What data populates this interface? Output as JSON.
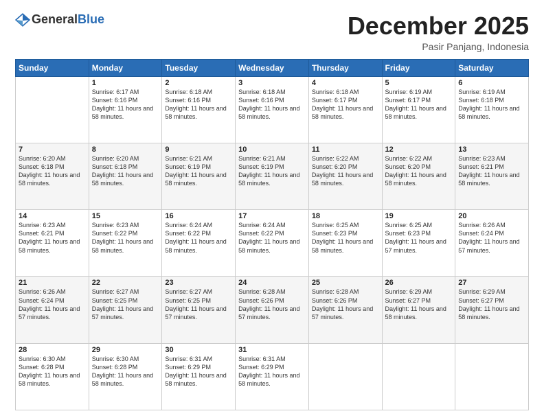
{
  "header": {
    "logo_general": "General",
    "logo_blue": "Blue",
    "month_title": "December 2025",
    "location": "Pasir Panjang, Indonesia"
  },
  "days_of_week": [
    "Sunday",
    "Monday",
    "Tuesday",
    "Wednesday",
    "Thursday",
    "Friday",
    "Saturday"
  ],
  "weeks": [
    [
      {
        "day": "",
        "sunrise": "",
        "sunset": "",
        "daylight": ""
      },
      {
        "day": "1",
        "sunrise": "6:17 AM",
        "sunset": "6:16 PM",
        "daylight": "11 hours and 58 minutes."
      },
      {
        "day": "2",
        "sunrise": "6:18 AM",
        "sunset": "6:16 PM",
        "daylight": "11 hours and 58 minutes."
      },
      {
        "day": "3",
        "sunrise": "6:18 AM",
        "sunset": "6:16 PM",
        "daylight": "11 hours and 58 minutes."
      },
      {
        "day": "4",
        "sunrise": "6:18 AM",
        "sunset": "6:17 PM",
        "daylight": "11 hours and 58 minutes."
      },
      {
        "day": "5",
        "sunrise": "6:19 AM",
        "sunset": "6:17 PM",
        "daylight": "11 hours and 58 minutes."
      },
      {
        "day": "6",
        "sunrise": "6:19 AM",
        "sunset": "6:18 PM",
        "daylight": "11 hours and 58 minutes."
      }
    ],
    [
      {
        "day": "7",
        "sunrise": "6:20 AM",
        "sunset": "6:18 PM",
        "daylight": "11 hours and 58 minutes."
      },
      {
        "day": "8",
        "sunrise": "6:20 AM",
        "sunset": "6:18 PM",
        "daylight": "11 hours and 58 minutes."
      },
      {
        "day": "9",
        "sunrise": "6:21 AM",
        "sunset": "6:19 PM",
        "daylight": "11 hours and 58 minutes."
      },
      {
        "day": "10",
        "sunrise": "6:21 AM",
        "sunset": "6:19 PM",
        "daylight": "11 hours and 58 minutes."
      },
      {
        "day": "11",
        "sunrise": "6:22 AM",
        "sunset": "6:20 PM",
        "daylight": "11 hours and 58 minutes."
      },
      {
        "day": "12",
        "sunrise": "6:22 AM",
        "sunset": "6:20 PM",
        "daylight": "11 hours and 58 minutes."
      },
      {
        "day": "13",
        "sunrise": "6:23 AM",
        "sunset": "6:21 PM",
        "daylight": "11 hours and 58 minutes."
      }
    ],
    [
      {
        "day": "14",
        "sunrise": "6:23 AM",
        "sunset": "6:21 PM",
        "daylight": "11 hours and 58 minutes."
      },
      {
        "day": "15",
        "sunrise": "6:23 AM",
        "sunset": "6:22 PM",
        "daylight": "11 hours and 58 minutes."
      },
      {
        "day": "16",
        "sunrise": "6:24 AM",
        "sunset": "6:22 PM",
        "daylight": "11 hours and 58 minutes."
      },
      {
        "day": "17",
        "sunrise": "6:24 AM",
        "sunset": "6:22 PM",
        "daylight": "11 hours and 58 minutes."
      },
      {
        "day": "18",
        "sunrise": "6:25 AM",
        "sunset": "6:23 PM",
        "daylight": "11 hours and 58 minutes."
      },
      {
        "day": "19",
        "sunrise": "6:25 AM",
        "sunset": "6:23 PM",
        "daylight": "11 hours and 57 minutes."
      },
      {
        "day": "20",
        "sunrise": "6:26 AM",
        "sunset": "6:24 PM",
        "daylight": "11 hours and 57 minutes."
      }
    ],
    [
      {
        "day": "21",
        "sunrise": "6:26 AM",
        "sunset": "6:24 PM",
        "daylight": "11 hours and 57 minutes."
      },
      {
        "day": "22",
        "sunrise": "6:27 AM",
        "sunset": "6:25 PM",
        "daylight": "11 hours and 57 minutes."
      },
      {
        "day": "23",
        "sunrise": "6:27 AM",
        "sunset": "6:25 PM",
        "daylight": "11 hours and 57 minutes."
      },
      {
        "day": "24",
        "sunrise": "6:28 AM",
        "sunset": "6:26 PM",
        "daylight": "11 hours and 57 minutes."
      },
      {
        "day": "25",
        "sunrise": "6:28 AM",
        "sunset": "6:26 PM",
        "daylight": "11 hours and 57 minutes."
      },
      {
        "day": "26",
        "sunrise": "6:29 AM",
        "sunset": "6:27 PM",
        "daylight": "11 hours and 58 minutes."
      },
      {
        "day": "27",
        "sunrise": "6:29 AM",
        "sunset": "6:27 PM",
        "daylight": "11 hours and 58 minutes."
      }
    ],
    [
      {
        "day": "28",
        "sunrise": "6:30 AM",
        "sunset": "6:28 PM",
        "daylight": "11 hours and 58 minutes."
      },
      {
        "day": "29",
        "sunrise": "6:30 AM",
        "sunset": "6:28 PM",
        "daylight": "11 hours and 58 minutes."
      },
      {
        "day": "30",
        "sunrise": "6:31 AM",
        "sunset": "6:29 PM",
        "daylight": "11 hours and 58 minutes."
      },
      {
        "day": "31",
        "sunrise": "6:31 AM",
        "sunset": "6:29 PM",
        "daylight": "11 hours and 58 minutes."
      },
      {
        "day": "",
        "sunrise": "",
        "sunset": "",
        "daylight": ""
      },
      {
        "day": "",
        "sunrise": "",
        "sunset": "",
        "daylight": ""
      },
      {
        "day": "",
        "sunrise": "",
        "sunset": "",
        "daylight": ""
      }
    ]
  ],
  "labels": {
    "sunrise_prefix": "Sunrise: ",
    "sunset_prefix": "Sunset: ",
    "daylight_prefix": "Daylight: "
  }
}
